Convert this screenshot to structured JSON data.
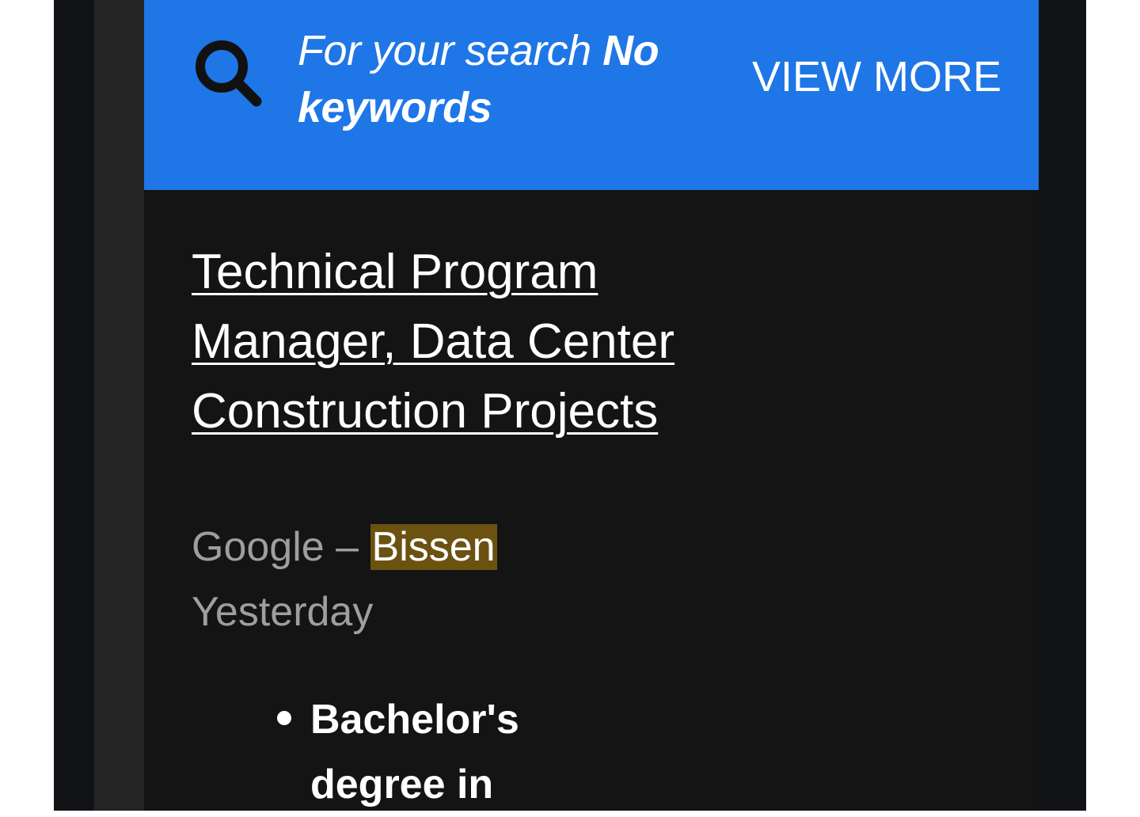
{
  "search_banner": {
    "prefix": "For your search ",
    "keywords": "No keywords",
    "view_more_label": "VIEW MORE",
    "icon": "search-icon",
    "background_color": "#1f76e6"
  },
  "job": {
    "title": "Technical Program Manager, Data Center Construction Projects",
    "company": "Google",
    "separator": " – ",
    "location": "Bissen",
    "posted": "Yesterday",
    "highlight_color": "#6b5211",
    "bullets": [
      "Bachelor's degree in"
    ]
  }
}
